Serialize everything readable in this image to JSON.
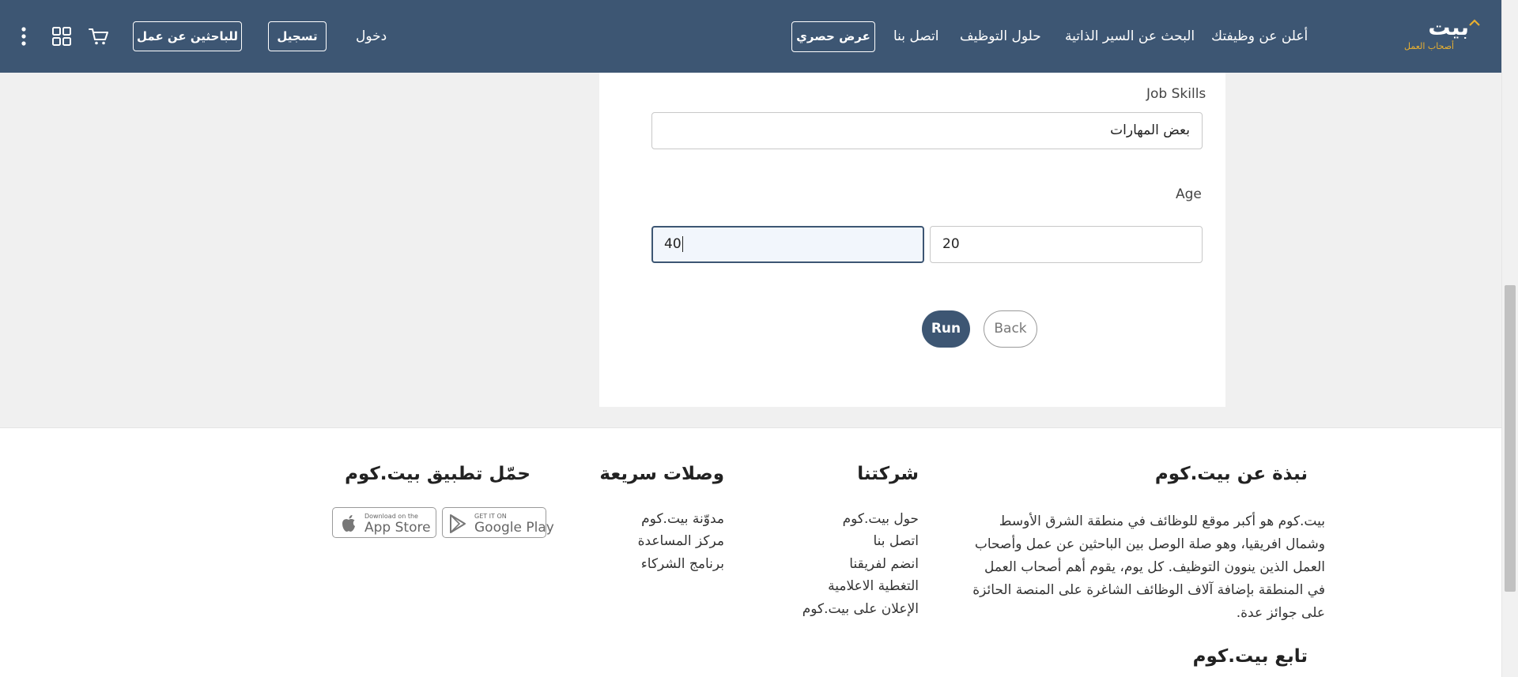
{
  "header": {
    "logo": {
      "main": "بيت",
      "sub": "أصحاب العمل"
    },
    "nav": {
      "post_job": "أعلن عن وظيفتك",
      "cv_search": "البحث عن السير الذاتية",
      "hiring_solutions": "حلول التوظيف",
      "contact": "اتصل بنا",
      "exclusive_offer": "عرض حصري"
    },
    "login": "دخول",
    "register": "تسجيل",
    "job_seekers": "للباحثين عن عمل",
    "icons": [
      "cart-icon",
      "apps-grid-icon",
      "more-vertical-icon"
    ],
    "background": "#3d5673"
  },
  "form": {
    "job_skills": {
      "label": "Job Skills",
      "value": "بعض المهارات"
    },
    "age": {
      "label": "Age",
      "min_value": "20",
      "max_value": "40"
    },
    "run_label": "Run",
    "back_label": "Back"
  },
  "footer": {
    "about": {
      "heading": "نبذة عن بيت.كوم",
      "text": "بيت.كوم هو أكبر موقع للوظائف في منطقة الشرق الأوسط وشمال افريقيا، وهو صلة الوصل بين الباحثين عن عمل وأصحاب العمل الذين ينوون التوظيف. كل يوم، يقوم أهم أصحاب العمل في المنطقة بإضافة آلاف الوظائف الشاغرة على المنصة الحائزة على جوائز عدة."
    },
    "follow_heading": "تابع بيت.كوم",
    "company": {
      "heading": "شركتنا",
      "links": [
        "حول بيت.كوم",
        "اتصل بنا",
        "انضم لفريقنا",
        "التغطية الاعلامية",
        "الإعلان على بيت.كوم"
      ]
    },
    "quick_links": {
      "heading": "وصلات سريعة",
      "links": [
        "مدوّنة بيت.كوم",
        "مركز المساعدة",
        "برنامج الشركاء"
      ]
    },
    "app": {
      "heading": "حمّل تطبيق بيت.كوم",
      "google_play": {
        "small": "GET IT ON",
        "big": "Google Play"
      },
      "app_store": {
        "small": "Download on the",
        "big": "App Store"
      }
    }
  }
}
